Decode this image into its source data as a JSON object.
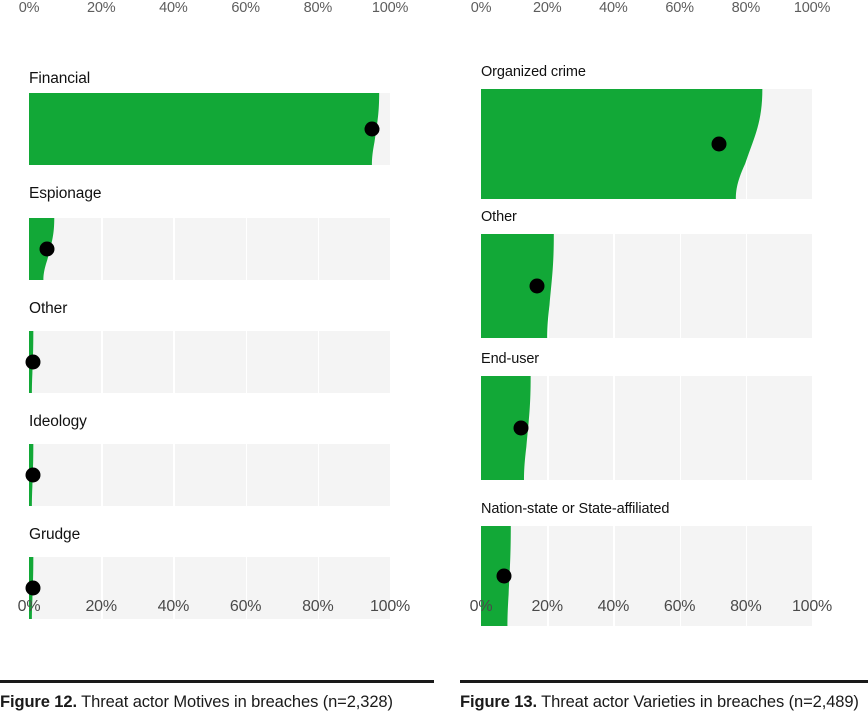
{
  "figures": [
    {
      "id": "figure-12",
      "caption_label": "Figure 12.",
      "caption_text": " Threat actor Motives in breaches (n=2,328)",
      "axis_ticks": [
        "0%",
        "20%",
        "40%",
        "60%",
        "80%",
        "100%"
      ],
      "bars": [
        {
          "label": "Financial",
          "value": 95
        },
        {
          "label": "Espionage",
          "value": 5
        },
        {
          "label": "Other",
          "value": 1
        },
        {
          "label": "Ideology",
          "value": 1
        },
        {
          "label": "Grudge",
          "value": 1
        }
      ]
    },
    {
      "id": "figure-13",
      "caption_label": "Figure 13.",
      "caption_text": " Threat actor Varieties in breaches (n=2,489)",
      "axis_ticks": [
        "0%",
        "20%",
        "40%",
        "60%",
        "80%",
        "100%"
      ],
      "bars": [
        {
          "label": "Organized crime",
          "value": 72
        },
        {
          "label": "Other",
          "value": 17
        },
        {
          "label": "End-user",
          "value": 12
        },
        {
          "label": "Nation-state or State-affiliated",
          "value": 7
        }
      ]
    }
  ],
  "chart_data": [
    {
      "type": "bar",
      "title": "Figure 12. Threat actor Motives in breaches (n=2,328)",
      "subtitle": "",
      "xlabel": "",
      "ylabel": "",
      "xlim": [
        0,
        100
      ],
      "xtick_labels": [
        "0%",
        "20%",
        "40%",
        "60%",
        "80%",
        "100%"
      ],
      "xticks": [
        0,
        20,
        40,
        60,
        80,
        100
      ],
      "grid": true,
      "legend": "none",
      "orientation": "horizontal",
      "sample_size": "n=2,328",
      "categories": [
        "Financial",
        "Espionage",
        "Other",
        "Ideology",
        "Grudge"
      ],
      "values": [
        95,
        5,
        1,
        1,
        1
      ],
      "confidence_bands": [
        {
          "category": "Financial",
          "upper_top": 97,
          "upper_bottom": 95
        },
        {
          "category": "Espionage",
          "upper_top": 7,
          "upper_bottom": 4
        },
        {
          "category": "Other",
          "upper_top": 1.2,
          "upper_bottom": 0.8
        },
        {
          "category": "Ideology",
          "upper_top": 1.2,
          "upper_bottom": 0.8
        },
        {
          "category": "Grudge",
          "upper_top": 1.2,
          "upper_bottom": 0.8
        }
      ],
      "annotations": [
        "Black dot marks the point estimate; green region shows the uncertainty band."
      ]
    },
    {
      "type": "bar",
      "title": "Figure 13. Threat actor Varieties in breaches (n=2,489)",
      "subtitle": "",
      "xlabel": "",
      "ylabel": "",
      "xlim": [
        0,
        100
      ],
      "xtick_labels": [
        "0%",
        "20%",
        "40%",
        "60%",
        "80%",
        "100%"
      ],
      "xticks": [
        0,
        20,
        40,
        60,
        80,
        100
      ],
      "grid": true,
      "legend": "none",
      "orientation": "horizontal",
      "sample_size": "n=2,489",
      "categories": [
        "Organized crime",
        "Other",
        "End-user",
        "Nation-state or State-affiliated"
      ],
      "values": [
        72,
        17,
        12,
        7
      ],
      "confidence_bands": [
        {
          "category": "Organized crime",
          "upper_top": 85,
          "upper_bottom": 77
        },
        {
          "category": "Other",
          "upper_top": 22,
          "upper_bottom": 20
        },
        {
          "category": "End-user",
          "upper_top": 15,
          "upper_bottom": 13
        },
        {
          "category": "Nation-state or State-affiliated",
          "upper_top": 9,
          "upper_bottom": 8
        }
      ],
      "annotations": [
        "Black dot marks the point estimate; green region shows the uncertainty band."
      ]
    }
  ],
  "colors": {
    "bar_green": "#12a837",
    "track_gray": "#f4f4f4",
    "gridline": "#ffffff",
    "dot": "#000000",
    "tick_text": "#5d5d5d",
    "caption_text": "#1a1a1a",
    "rule": "#1a1a1a"
  }
}
